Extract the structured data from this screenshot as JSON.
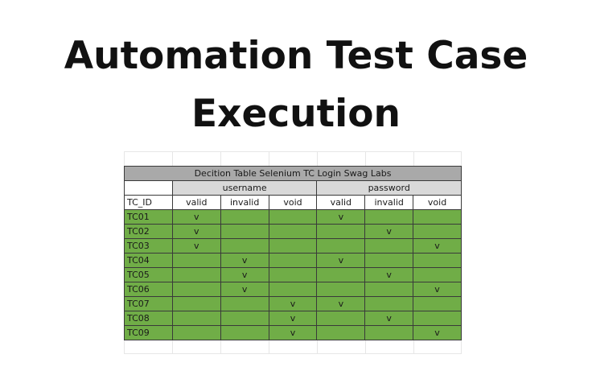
{
  "title": {
    "line1": "Automation Test Case",
    "line2": "Execution"
  },
  "table": {
    "caption": "Decition Table Selenium TC Login Swag Labs",
    "groups": {
      "username": "username",
      "password": "password"
    },
    "headers": [
      "TC_ID",
      "valid",
      "invalid",
      "void",
      "valid",
      "invalid",
      "void"
    ],
    "rows": [
      [
        "TC01",
        "v",
        "",
        "",
        "v",
        "",
        ""
      ],
      [
        "TC02",
        "v",
        "",
        "",
        "",
        "v",
        ""
      ],
      [
        "TC03",
        "v",
        "",
        "",
        "",
        "",
        "v"
      ],
      [
        "TC04",
        "",
        "v",
        "",
        "v",
        "",
        ""
      ],
      [
        "TC05",
        "",
        "v",
        "",
        "",
        "v",
        ""
      ],
      [
        "TC06",
        "",
        "v",
        "",
        "",
        "",
        "v"
      ],
      [
        "TC07",
        "",
        "",
        "v",
        "v",
        "",
        ""
      ],
      [
        "TC08",
        "",
        "",
        "v",
        "",
        "v",
        ""
      ],
      [
        "TC09",
        "",
        "",
        "v",
        "",
        "",
        "v"
      ]
    ],
    "colors": {
      "caption_bg": "#a9a9a9",
      "group_bg": "#d9d9d9",
      "data_bg": "#70ad47"
    }
  }
}
